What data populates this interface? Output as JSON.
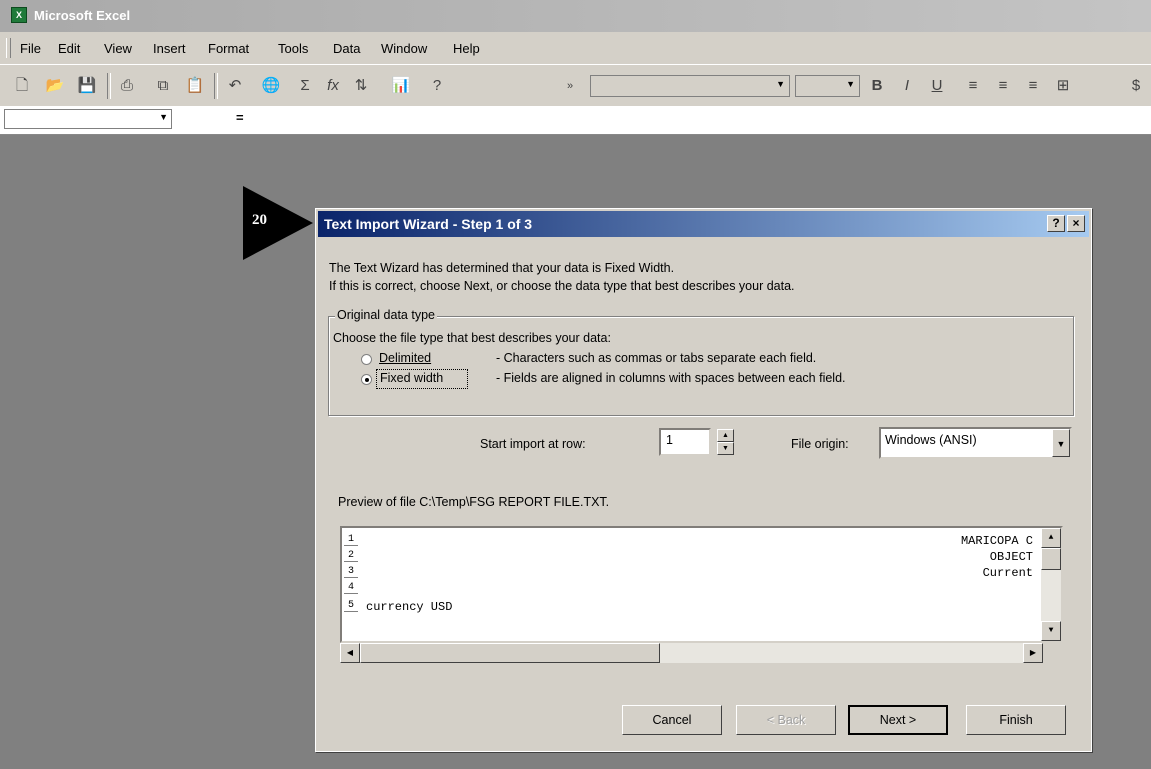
{
  "app": {
    "title": "Microsoft Excel",
    "icon": "excel-app-icon"
  },
  "menu": [
    "File",
    "Edit",
    "View",
    "Insert",
    "Format",
    "Tools",
    "Data",
    "Window",
    "Help"
  ],
  "toolbar": {
    "icons": [
      "new-document-icon",
      "open-folder-icon",
      "save-icon",
      "print-icon",
      "copy-icon",
      "paste-icon",
      "undo-icon",
      "hyperlink-icon",
      "autosum-icon",
      "function-icon",
      "sort-ascending-icon",
      "chart-icon",
      "help-icon",
      "more-buttons-icon",
      "bold-icon",
      "italic-icon",
      "underline-icon",
      "align-left-icon",
      "center-icon",
      "align-right-icon",
      "merge-cells-icon",
      "currency-icon"
    ],
    "bold": "B",
    "italic": "I",
    "underline": "U"
  },
  "formula_bar": {
    "name_box": "",
    "equals": "="
  },
  "callout": {
    "number": "20"
  },
  "dialog": {
    "title": "Text Import Wizard - Step 1 of 3",
    "help_button": "?",
    "close_button": "×",
    "intro_line1": "The Text Wizard has determined that your data is Fixed Width.",
    "intro_line2": "If this is correct, choose Next, or choose the data type that best describes your data.",
    "group_label": "Original data type",
    "group_prompt": "Choose the file type that best describes your data:",
    "options": [
      {
        "label": "Delimited",
        "description": "- Characters such as commas or tabs separate each field.",
        "checked": false
      },
      {
        "label": "Fixed width",
        "description": "- Fields are aligned in columns with spaces between each field.",
        "checked": true
      }
    ],
    "start_row_label": "Start import at row:",
    "start_row_value": "1",
    "file_origin_label": "File origin:",
    "file_origin_value": "Windows (ANSI)",
    "preview_label": "Preview of file C:\\Temp\\FSG REPORT FILE.TXT.",
    "preview_rows": [
      {
        "num": "1",
        "left": "",
        "right": "MARICOPA C"
      },
      {
        "num": "2",
        "left": "",
        "right": "OBJECT"
      },
      {
        "num": "3",
        "left": "",
        "right": "Current"
      },
      {
        "num": "4",
        "left": "",
        "right": ""
      },
      {
        "num": "5",
        "left": "currency USD",
        "right": ""
      }
    ],
    "buttons": {
      "cancel": "Cancel",
      "back": "< Back",
      "next": "Next >",
      "finish": "Finish"
    }
  }
}
